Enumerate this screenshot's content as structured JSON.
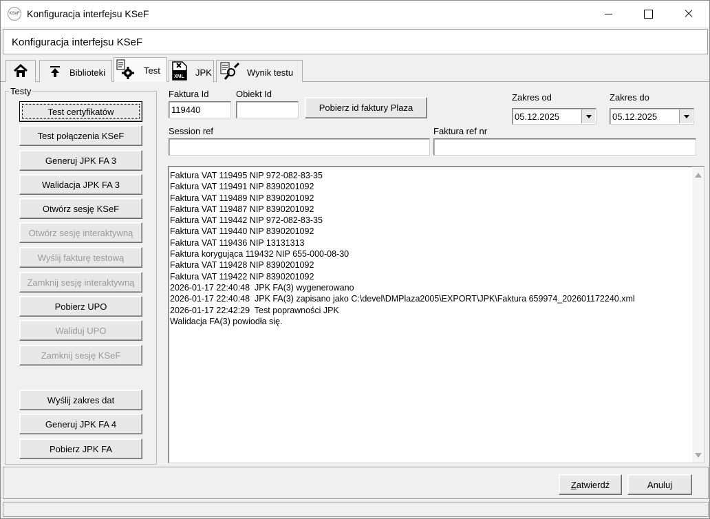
{
  "window": {
    "title": "Konfiguracja interfejsu KSeF",
    "icon_text": "KSeF"
  },
  "header": {
    "title": "Konfiguracja interfejsu KSeF"
  },
  "tabs": [
    {
      "label": "",
      "icon": "home-icon"
    },
    {
      "label": "Biblioteki",
      "icon": "upload-arrow-icon"
    },
    {
      "label": "Test",
      "icon": "gear-document-icon",
      "active": true
    },
    {
      "label": "JPK",
      "icon": "xml-file-icon"
    },
    {
      "label": "Wynik testu",
      "icon": "magnifier-document-icon"
    }
  ],
  "group": {
    "label": "Testy",
    "buttons": [
      {
        "label": "Test certyfikatów",
        "enabled": true
      },
      {
        "label": "Test połączenia KSeF",
        "enabled": true
      },
      {
        "label": "Generuj JPK FA 3",
        "enabled": true
      },
      {
        "label": "Walidacja JPK FA 3",
        "enabled": true
      },
      {
        "label": "Otwórz sesję KSeF",
        "enabled": true
      },
      {
        "label": "Otwórz sesję interaktywną",
        "enabled": false
      },
      {
        "label": "Wyślij fakturę testową",
        "enabled": false
      },
      {
        "label": "Zamknij sesję interaktywną",
        "enabled": false
      },
      {
        "label": "Pobierz UPO",
        "enabled": true
      },
      {
        "label": "Waliduj UPO",
        "enabled": false
      },
      {
        "label": "Zamknij sesję KSeF",
        "enabled": false
      },
      {
        "label": "Wyślij zakres dat",
        "enabled": true
      },
      {
        "label": "Generuj JPK FA 4",
        "enabled": true
      },
      {
        "label": "Pobierz JPK FA",
        "enabled": true
      }
    ]
  },
  "form": {
    "faktura_id_label": "Faktura Id",
    "faktura_id_value": "119440",
    "obiekt_id_label": "Obiekt Id",
    "obiekt_id_value": "",
    "pobierz_button": "Pobierz id faktury Plaza",
    "zakres_od_label": "Zakres od",
    "zakres_od_value": "05.12.2025",
    "zakres_do_label": "Zakres do",
    "zakres_do_value": "05.12.2025",
    "session_ref_label": "Session ref",
    "session_ref_value": "",
    "faktura_ref_label": "Faktura ref nr",
    "faktura_ref_value": ""
  },
  "log": [
    "Faktura VAT 119495 NIP 972-082-83-35",
    "Faktura VAT 119491 NIP 8390201092",
    "Faktura VAT 119489 NIP 8390201092",
    "Faktura VAT 119487 NIP 8390201092",
    "Faktura VAT 119442 NIP 972-082-83-35",
    "Faktura VAT 119440 NIP 8390201092",
    "Faktura VAT 119436 NIP 13131313",
    "Faktura korygująca 119432 NIP 655-000-08-30",
    "Faktura VAT 119428 NIP 8390201092",
    "Faktura VAT 119422 NIP 8390201092",
    "2026-01-17 22:40:48  JPK FA(3) wygenerowano",
    "2026-01-17 22:40:48  JPK FA(3) zapisano jako C:\\devel\\DMPlaza2005\\EXPORT\\JPK\\Faktura 659974_202601172240.xml",
    "2026-01-17 22:42:29  Test poprawności JPK",
    "Walidacja FA(3) powiodła się."
  ],
  "footer": {
    "confirm_first": "Z",
    "confirm_rest": "atwierdź",
    "cancel": "Anuluj"
  }
}
